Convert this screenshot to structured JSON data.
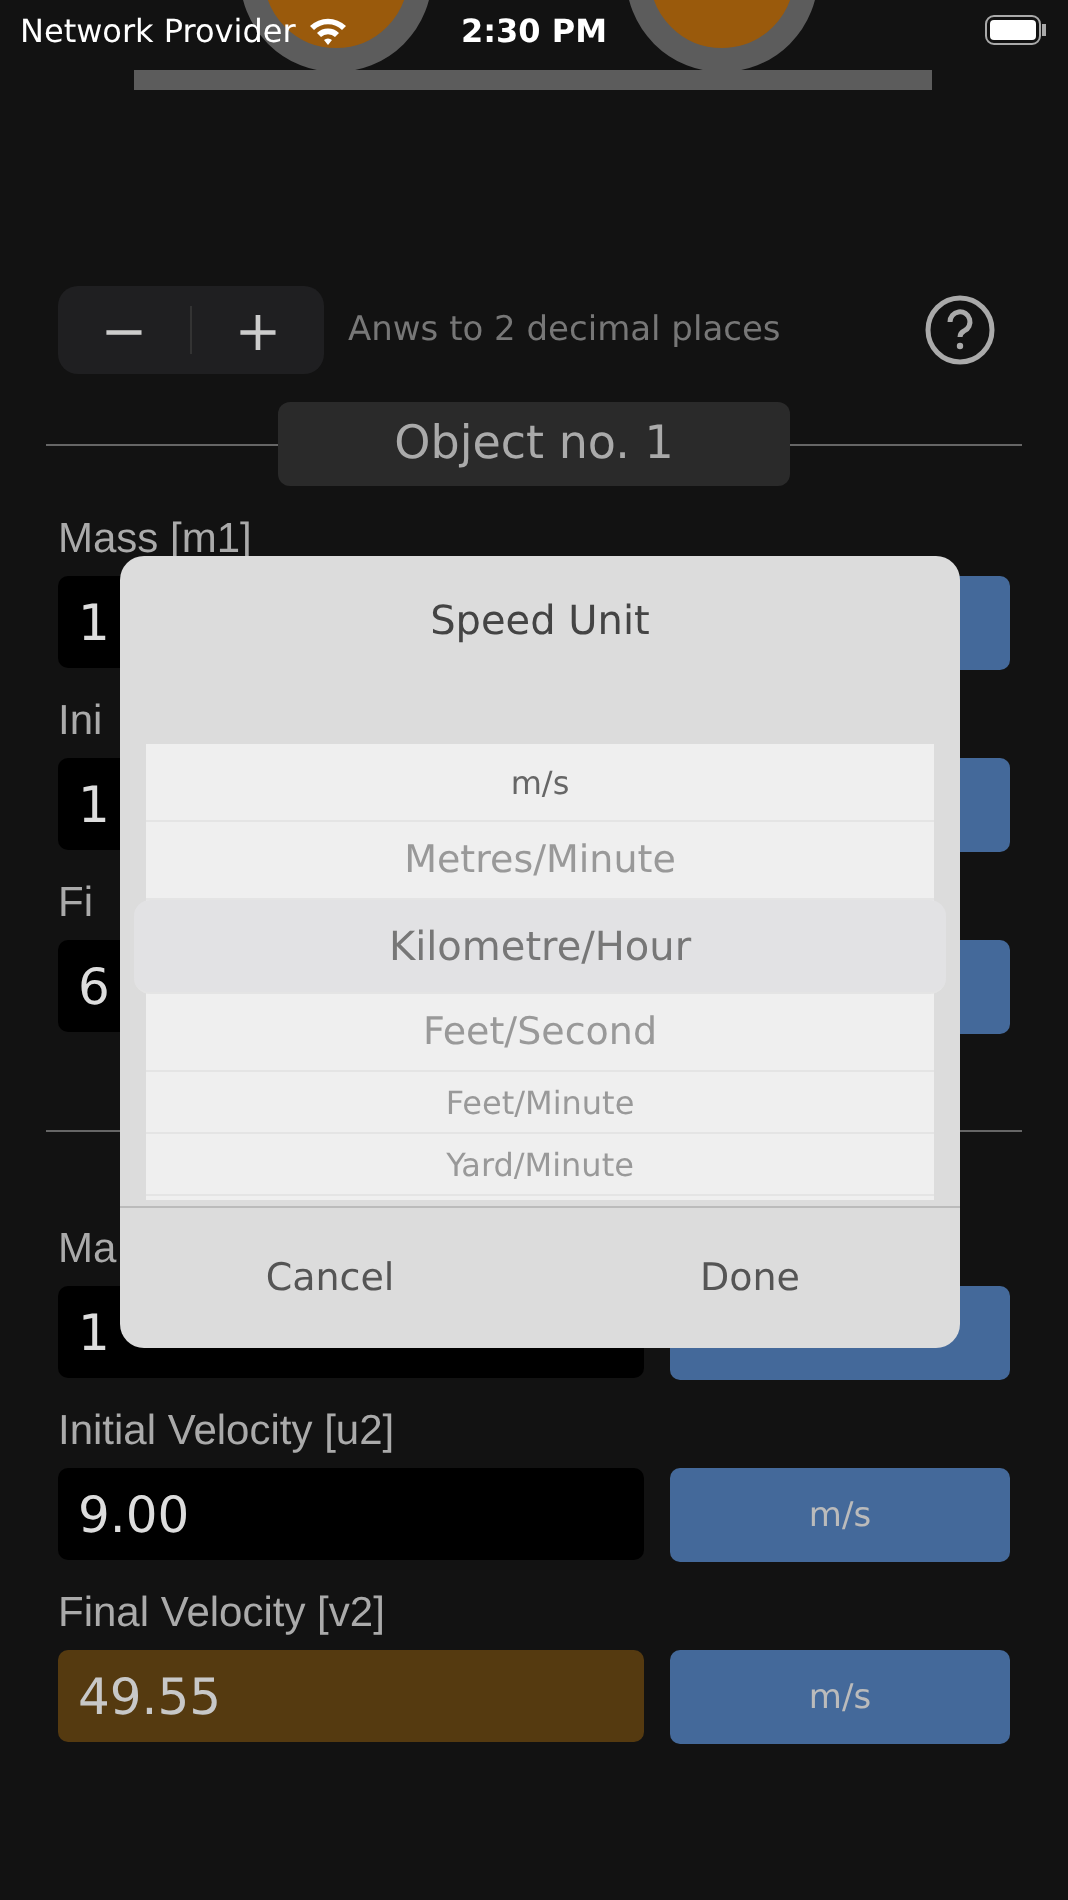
{
  "status_bar": {
    "carrier": "Network Provider",
    "time": "2:30 PM"
  },
  "precision": {
    "minus": "−",
    "plus": "+",
    "label": "Anws to 2 decimal places"
  },
  "objects": [
    {
      "title": "Object no. 1",
      "fields": [
        {
          "label": "Mass [m1]",
          "value": "1",
          "kind": "input"
        },
        {
          "label": "Ini",
          "value": "1",
          "kind": "input"
        },
        {
          "label": "Fi",
          "value": "6",
          "kind": "input"
        }
      ]
    },
    {
      "fields": [
        {
          "label": "Ma",
          "value": "1",
          "kind": "input"
        },
        {
          "label": "Initial Velocity [u2]",
          "value": "9.00",
          "unit": "m/s",
          "kind": "input"
        },
        {
          "label": "Final Velocity [v2]",
          "value": "49.55",
          "unit": "m/s",
          "kind": "result"
        }
      ]
    }
  ],
  "dialog": {
    "title": "Speed Unit",
    "options": [
      {
        "label": "m/s",
        "selected": false
      },
      {
        "label": "Metres/Minute",
        "selected": false
      },
      {
        "label": "Kilometre/Hour",
        "selected": true
      },
      {
        "label": "Feet/Second",
        "selected": false
      },
      {
        "label": "Feet/Minute",
        "selected": false
      },
      {
        "label": "Yard/Minute",
        "selected": false
      }
    ],
    "buttons": [
      "Cancel",
      "Done"
    ]
  }
}
